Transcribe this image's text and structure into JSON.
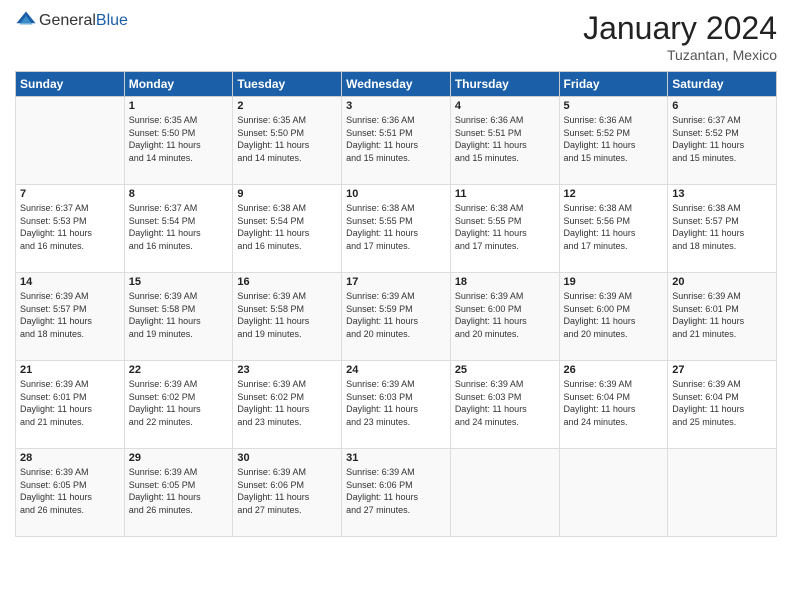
{
  "logo": {
    "general": "General",
    "blue": "Blue"
  },
  "title": "January 2024",
  "location": "Tuzantan, Mexico",
  "days_of_week": [
    "Sunday",
    "Monday",
    "Tuesday",
    "Wednesday",
    "Thursday",
    "Friday",
    "Saturday"
  ],
  "weeks": [
    [
      {
        "num": "",
        "info": ""
      },
      {
        "num": "1",
        "info": "Sunrise: 6:35 AM\nSunset: 5:50 PM\nDaylight: 11 hours\nand 14 minutes."
      },
      {
        "num": "2",
        "info": "Sunrise: 6:35 AM\nSunset: 5:50 PM\nDaylight: 11 hours\nand 14 minutes."
      },
      {
        "num": "3",
        "info": "Sunrise: 6:36 AM\nSunset: 5:51 PM\nDaylight: 11 hours\nand 15 minutes."
      },
      {
        "num": "4",
        "info": "Sunrise: 6:36 AM\nSunset: 5:51 PM\nDaylight: 11 hours\nand 15 minutes."
      },
      {
        "num": "5",
        "info": "Sunrise: 6:36 AM\nSunset: 5:52 PM\nDaylight: 11 hours\nand 15 minutes."
      },
      {
        "num": "6",
        "info": "Sunrise: 6:37 AM\nSunset: 5:52 PM\nDaylight: 11 hours\nand 15 minutes."
      }
    ],
    [
      {
        "num": "7",
        "info": "Sunrise: 6:37 AM\nSunset: 5:53 PM\nDaylight: 11 hours\nand 16 minutes."
      },
      {
        "num": "8",
        "info": "Sunrise: 6:37 AM\nSunset: 5:54 PM\nDaylight: 11 hours\nand 16 minutes."
      },
      {
        "num": "9",
        "info": "Sunrise: 6:38 AM\nSunset: 5:54 PM\nDaylight: 11 hours\nand 16 minutes."
      },
      {
        "num": "10",
        "info": "Sunrise: 6:38 AM\nSunset: 5:55 PM\nDaylight: 11 hours\nand 17 minutes."
      },
      {
        "num": "11",
        "info": "Sunrise: 6:38 AM\nSunset: 5:55 PM\nDaylight: 11 hours\nand 17 minutes."
      },
      {
        "num": "12",
        "info": "Sunrise: 6:38 AM\nSunset: 5:56 PM\nDaylight: 11 hours\nand 17 minutes."
      },
      {
        "num": "13",
        "info": "Sunrise: 6:38 AM\nSunset: 5:57 PM\nDaylight: 11 hours\nand 18 minutes."
      }
    ],
    [
      {
        "num": "14",
        "info": "Sunrise: 6:39 AM\nSunset: 5:57 PM\nDaylight: 11 hours\nand 18 minutes."
      },
      {
        "num": "15",
        "info": "Sunrise: 6:39 AM\nSunset: 5:58 PM\nDaylight: 11 hours\nand 19 minutes."
      },
      {
        "num": "16",
        "info": "Sunrise: 6:39 AM\nSunset: 5:58 PM\nDaylight: 11 hours\nand 19 minutes."
      },
      {
        "num": "17",
        "info": "Sunrise: 6:39 AM\nSunset: 5:59 PM\nDaylight: 11 hours\nand 20 minutes."
      },
      {
        "num": "18",
        "info": "Sunrise: 6:39 AM\nSunset: 6:00 PM\nDaylight: 11 hours\nand 20 minutes."
      },
      {
        "num": "19",
        "info": "Sunrise: 6:39 AM\nSunset: 6:00 PM\nDaylight: 11 hours\nand 20 minutes."
      },
      {
        "num": "20",
        "info": "Sunrise: 6:39 AM\nSunset: 6:01 PM\nDaylight: 11 hours\nand 21 minutes."
      }
    ],
    [
      {
        "num": "21",
        "info": "Sunrise: 6:39 AM\nSunset: 6:01 PM\nDaylight: 11 hours\nand 21 minutes."
      },
      {
        "num": "22",
        "info": "Sunrise: 6:39 AM\nSunset: 6:02 PM\nDaylight: 11 hours\nand 22 minutes."
      },
      {
        "num": "23",
        "info": "Sunrise: 6:39 AM\nSunset: 6:02 PM\nDaylight: 11 hours\nand 23 minutes."
      },
      {
        "num": "24",
        "info": "Sunrise: 6:39 AM\nSunset: 6:03 PM\nDaylight: 11 hours\nand 23 minutes."
      },
      {
        "num": "25",
        "info": "Sunrise: 6:39 AM\nSunset: 6:03 PM\nDaylight: 11 hours\nand 24 minutes."
      },
      {
        "num": "26",
        "info": "Sunrise: 6:39 AM\nSunset: 6:04 PM\nDaylight: 11 hours\nand 24 minutes."
      },
      {
        "num": "27",
        "info": "Sunrise: 6:39 AM\nSunset: 6:04 PM\nDaylight: 11 hours\nand 25 minutes."
      }
    ],
    [
      {
        "num": "28",
        "info": "Sunrise: 6:39 AM\nSunset: 6:05 PM\nDaylight: 11 hours\nand 26 minutes."
      },
      {
        "num": "29",
        "info": "Sunrise: 6:39 AM\nSunset: 6:05 PM\nDaylight: 11 hours\nand 26 minutes."
      },
      {
        "num": "30",
        "info": "Sunrise: 6:39 AM\nSunset: 6:06 PM\nDaylight: 11 hours\nand 27 minutes."
      },
      {
        "num": "31",
        "info": "Sunrise: 6:39 AM\nSunset: 6:06 PM\nDaylight: 11 hours\nand 27 minutes."
      },
      {
        "num": "",
        "info": ""
      },
      {
        "num": "",
        "info": ""
      },
      {
        "num": "",
        "info": ""
      }
    ]
  ]
}
